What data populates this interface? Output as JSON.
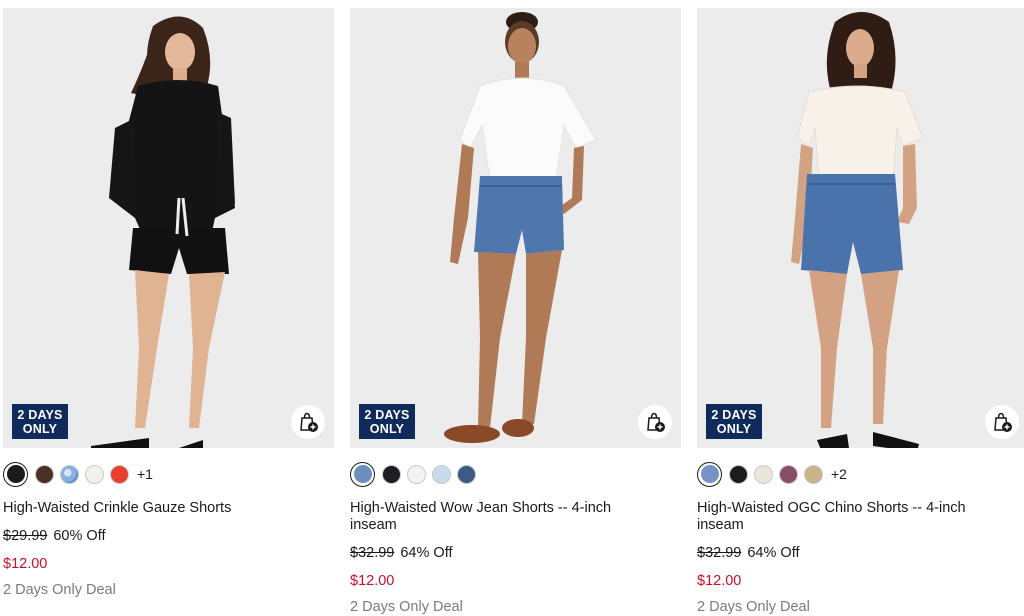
{
  "products": [
    {
      "badge_line1": "2 DAYS",
      "badge_line2": "ONLY",
      "title": "High-Waisted Crinkle Gauze Shorts",
      "original_price": "$29.99",
      "discount": "60% Off",
      "sale_price": "$12.00",
      "deal_label": "2 Days Only Deal",
      "swatches": [
        "#1b1b1b",
        "#4a3026",
        "#8ab0e0",
        "#f1f1ee",
        "#e8402e"
      ],
      "more_colors": "+1"
    },
    {
      "badge_line1": "2 DAYS",
      "badge_line2": "ONLY",
      "title": "High-Waisted Wow Jean Shorts -- 4-inch inseam",
      "original_price": "$32.99",
      "discount": "64% Off",
      "sale_price": "$12.00",
      "deal_label": "2 Days Only Deal",
      "swatches": [
        "#6c8fbf",
        "#1e1e22",
        "#f3f3f3",
        "#c9dbe8",
        "#3d5a85"
      ],
      "more_colors": ""
    },
    {
      "badge_line1": "2 DAYS",
      "badge_line2": "ONLY",
      "title": "High-Waisted OGC Chino Shorts -- 4-inch inseam",
      "original_price": "$32.99",
      "discount": "64% Off",
      "sale_price": "$12.00",
      "deal_label": "2 Days Only Deal",
      "swatches": [
        "#7593c4",
        "#1c1c1c",
        "#ebe6dc",
        "#8a4d66",
        "#c9b48a"
      ],
      "more_colors": "+2"
    }
  ],
  "colors": {
    "badge_bg": "#0f2b5b",
    "sale_red": "#c8102e",
    "photo_bg": "#ececec"
  },
  "icons": {
    "bag": "shopping-bag-add-icon"
  }
}
